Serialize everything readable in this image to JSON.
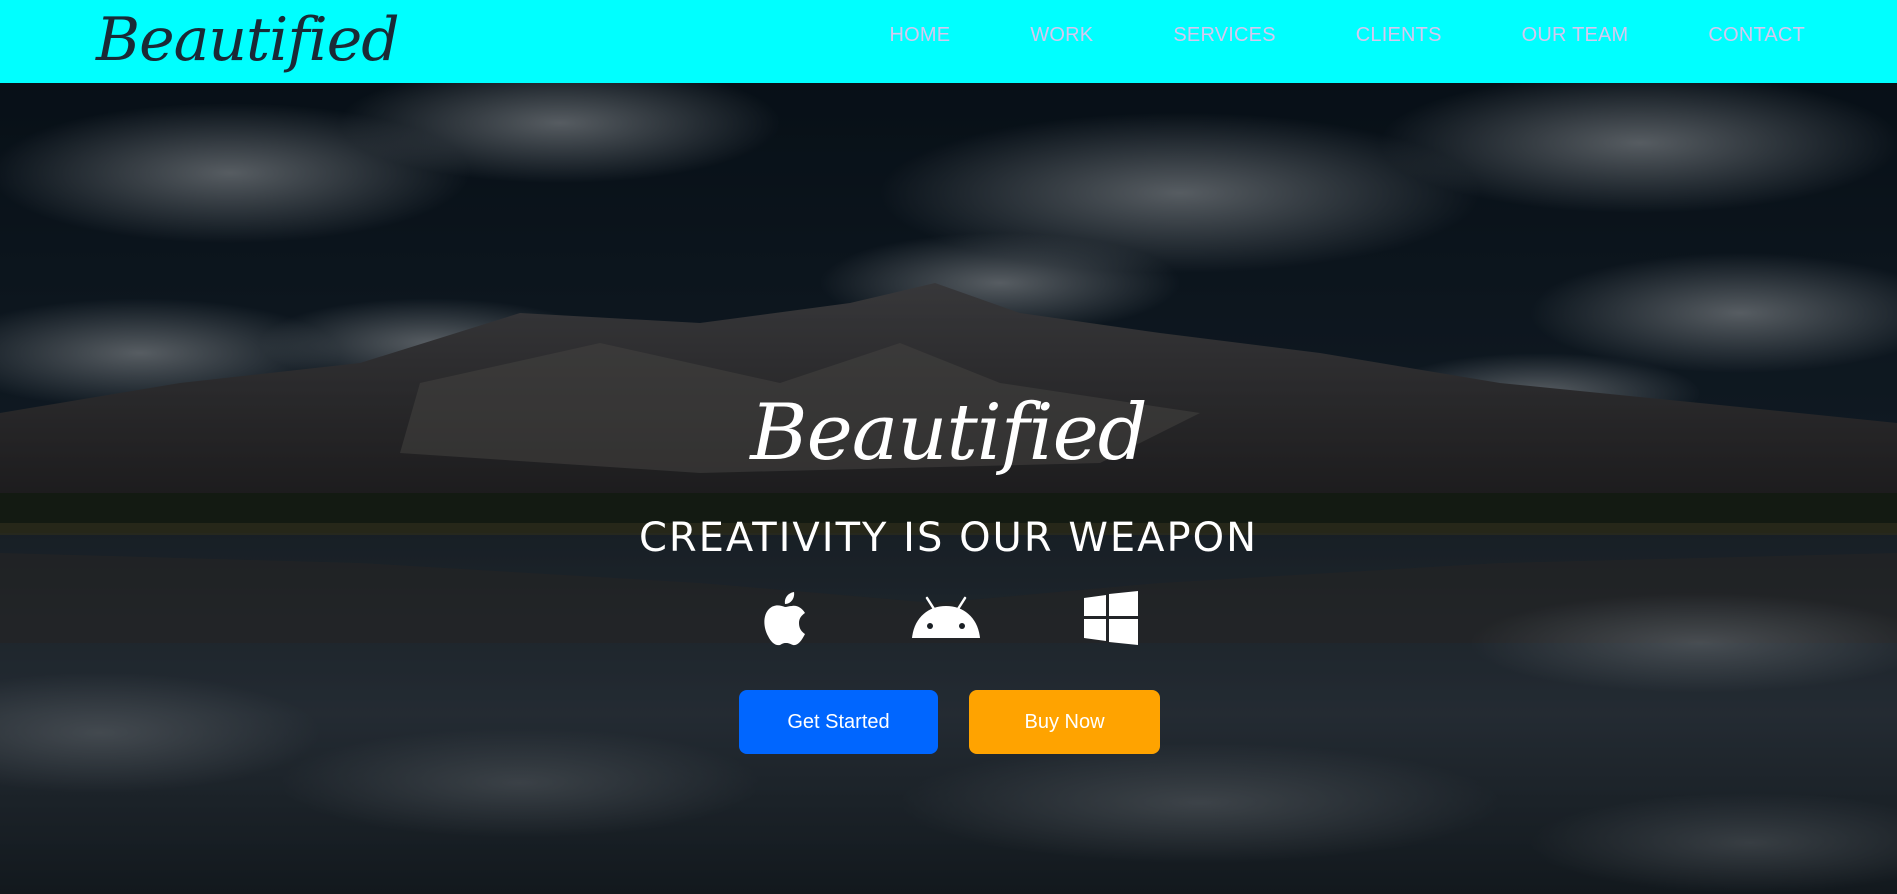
{
  "brand": {
    "name": "Beautified"
  },
  "nav": {
    "items": [
      {
        "label": "HOME"
      },
      {
        "label": "WORK"
      },
      {
        "label": "SERVICES"
      },
      {
        "label": "CLIENTS"
      },
      {
        "label": "OUR TEAM"
      },
      {
        "label": "CONTACT"
      }
    ]
  },
  "hero": {
    "title": "Beautified",
    "tagline": "CREATIVITY IS OUR WEAPON",
    "platform_icons": [
      "apple-icon",
      "android-icon",
      "windows-icon"
    ],
    "background": "mountain-lake-landscape"
  },
  "buttons": {
    "get_started": "Get Started",
    "buy_now": "Buy Now"
  },
  "colors": {
    "navbar_bg": "#00ffff",
    "nav_text": "#d7c7ef",
    "brand_text": "#1a2a36",
    "primary_button": "#0066ff",
    "secondary_button": "#ffa300",
    "hero_text": "#ffffff"
  }
}
